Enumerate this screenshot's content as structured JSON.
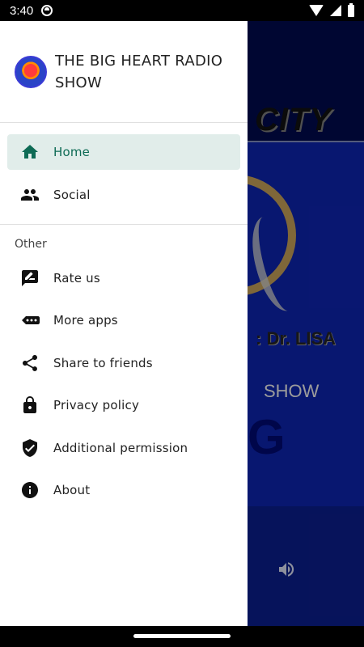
{
  "status_bar": {
    "time": "3:40"
  },
  "drawer": {
    "app_title": "THE BIG HEART RADIO SHOW",
    "primary_items": [
      {
        "label": "Home",
        "icon": "home-icon",
        "active": true
      },
      {
        "label": "Social",
        "icon": "people-icon",
        "active": false
      }
    ],
    "section_title": "Other",
    "other_items": [
      {
        "label": "Rate us",
        "icon": "rate-icon"
      },
      {
        "label": "More apps",
        "icon": "more-apps-icon"
      },
      {
        "label": "Share to friends",
        "icon": "share-icon"
      },
      {
        "label": "Privacy policy",
        "icon": "lock-icon"
      },
      {
        "label": "Additional permission",
        "icon": "shield-check-icon"
      },
      {
        "label": "About",
        "icon": "info-icon"
      }
    ]
  },
  "background_app": {
    "banner_text": "CITY",
    "artwork_text_1": ": Dr. LISA",
    "artwork_text_2": "SHOW",
    "artwork_big_text": "G"
  },
  "colors": {
    "accent": "#0e6b55",
    "active_bg": "#e1edea",
    "background_blue": "#0a1e8f"
  }
}
